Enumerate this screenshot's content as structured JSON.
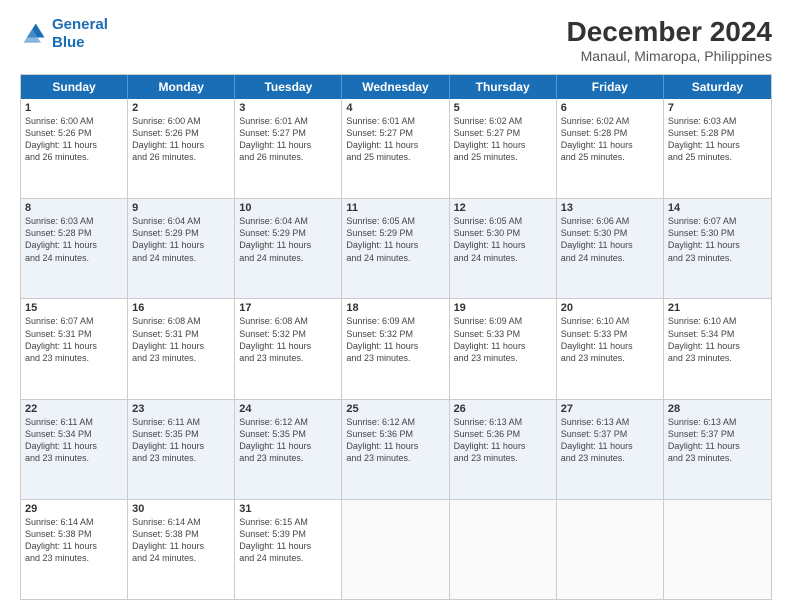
{
  "logo": {
    "line1": "General",
    "line2": "Blue"
  },
  "title": "December 2024",
  "subtitle": "Manaul, Mimaropa, Philippines",
  "weekdays": [
    "Sunday",
    "Monday",
    "Tuesday",
    "Wednesday",
    "Thursday",
    "Friday",
    "Saturday"
  ],
  "weeks": [
    [
      {
        "day": "1",
        "info": "Sunrise: 6:00 AM\nSunset: 5:26 PM\nDaylight: 11 hours\nand 26 minutes."
      },
      {
        "day": "2",
        "info": "Sunrise: 6:00 AM\nSunset: 5:26 PM\nDaylight: 11 hours\nand 26 minutes."
      },
      {
        "day": "3",
        "info": "Sunrise: 6:01 AM\nSunset: 5:27 PM\nDaylight: 11 hours\nand 26 minutes."
      },
      {
        "day": "4",
        "info": "Sunrise: 6:01 AM\nSunset: 5:27 PM\nDaylight: 11 hours\nand 25 minutes."
      },
      {
        "day": "5",
        "info": "Sunrise: 6:02 AM\nSunset: 5:27 PM\nDaylight: 11 hours\nand 25 minutes."
      },
      {
        "day": "6",
        "info": "Sunrise: 6:02 AM\nSunset: 5:28 PM\nDaylight: 11 hours\nand 25 minutes."
      },
      {
        "day": "7",
        "info": "Sunrise: 6:03 AM\nSunset: 5:28 PM\nDaylight: 11 hours\nand 25 minutes."
      }
    ],
    [
      {
        "day": "8",
        "info": "Sunrise: 6:03 AM\nSunset: 5:28 PM\nDaylight: 11 hours\nand 24 minutes."
      },
      {
        "day": "9",
        "info": "Sunrise: 6:04 AM\nSunset: 5:29 PM\nDaylight: 11 hours\nand 24 minutes."
      },
      {
        "day": "10",
        "info": "Sunrise: 6:04 AM\nSunset: 5:29 PM\nDaylight: 11 hours\nand 24 minutes."
      },
      {
        "day": "11",
        "info": "Sunrise: 6:05 AM\nSunset: 5:29 PM\nDaylight: 11 hours\nand 24 minutes."
      },
      {
        "day": "12",
        "info": "Sunrise: 6:05 AM\nSunset: 5:30 PM\nDaylight: 11 hours\nand 24 minutes."
      },
      {
        "day": "13",
        "info": "Sunrise: 6:06 AM\nSunset: 5:30 PM\nDaylight: 11 hours\nand 24 minutes."
      },
      {
        "day": "14",
        "info": "Sunrise: 6:07 AM\nSunset: 5:30 PM\nDaylight: 11 hours\nand 23 minutes."
      }
    ],
    [
      {
        "day": "15",
        "info": "Sunrise: 6:07 AM\nSunset: 5:31 PM\nDaylight: 11 hours\nand 23 minutes."
      },
      {
        "day": "16",
        "info": "Sunrise: 6:08 AM\nSunset: 5:31 PM\nDaylight: 11 hours\nand 23 minutes."
      },
      {
        "day": "17",
        "info": "Sunrise: 6:08 AM\nSunset: 5:32 PM\nDaylight: 11 hours\nand 23 minutes."
      },
      {
        "day": "18",
        "info": "Sunrise: 6:09 AM\nSunset: 5:32 PM\nDaylight: 11 hours\nand 23 minutes."
      },
      {
        "day": "19",
        "info": "Sunrise: 6:09 AM\nSunset: 5:33 PM\nDaylight: 11 hours\nand 23 minutes."
      },
      {
        "day": "20",
        "info": "Sunrise: 6:10 AM\nSunset: 5:33 PM\nDaylight: 11 hours\nand 23 minutes."
      },
      {
        "day": "21",
        "info": "Sunrise: 6:10 AM\nSunset: 5:34 PM\nDaylight: 11 hours\nand 23 minutes."
      }
    ],
    [
      {
        "day": "22",
        "info": "Sunrise: 6:11 AM\nSunset: 5:34 PM\nDaylight: 11 hours\nand 23 minutes."
      },
      {
        "day": "23",
        "info": "Sunrise: 6:11 AM\nSunset: 5:35 PM\nDaylight: 11 hours\nand 23 minutes."
      },
      {
        "day": "24",
        "info": "Sunrise: 6:12 AM\nSunset: 5:35 PM\nDaylight: 11 hours\nand 23 minutes."
      },
      {
        "day": "25",
        "info": "Sunrise: 6:12 AM\nSunset: 5:36 PM\nDaylight: 11 hours\nand 23 minutes."
      },
      {
        "day": "26",
        "info": "Sunrise: 6:13 AM\nSunset: 5:36 PM\nDaylight: 11 hours\nand 23 minutes."
      },
      {
        "day": "27",
        "info": "Sunrise: 6:13 AM\nSunset: 5:37 PM\nDaylight: 11 hours\nand 23 minutes."
      },
      {
        "day": "28",
        "info": "Sunrise: 6:13 AM\nSunset: 5:37 PM\nDaylight: 11 hours\nand 23 minutes."
      }
    ],
    [
      {
        "day": "29",
        "info": "Sunrise: 6:14 AM\nSunset: 5:38 PM\nDaylight: 11 hours\nand 23 minutes."
      },
      {
        "day": "30",
        "info": "Sunrise: 6:14 AM\nSunset: 5:38 PM\nDaylight: 11 hours\nand 24 minutes."
      },
      {
        "day": "31",
        "info": "Sunrise: 6:15 AM\nSunset: 5:39 PM\nDaylight: 11 hours\nand 24 minutes."
      },
      {
        "day": "",
        "info": ""
      },
      {
        "day": "",
        "info": ""
      },
      {
        "day": "",
        "info": ""
      },
      {
        "day": "",
        "info": ""
      }
    ]
  ],
  "row_alts": [
    false,
    true,
    false,
    true,
    false
  ]
}
